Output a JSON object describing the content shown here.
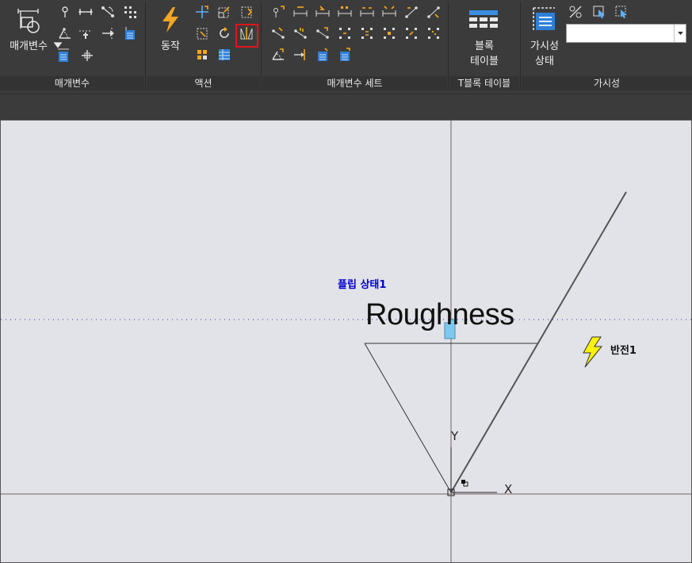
{
  "ribbon": {
    "panels": [
      {
        "label": "매개변수"
      },
      {
        "label": "액션"
      },
      {
        "label": "매개변수 세트"
      },
      {
        "label": "T블록 테이블"
      },
      {
        "label": "가시성"
      }
    ],
    "buttons": {
      "parameters_label": "매개변수",
      "action_label": "동작",
      "block_table_line1": "블록",
      "block_table_line2": "테이블",
      "visibility_line1": "가시성",
      "visibility_line2": "상태"
    },
    "visibility_combo": {
      "value": ""
    }
  },
  "canvas": {
    "flip_state_label": "플립 상태1",
    "roughness_text": "Roughness",
    "flip_param_label": "반전1",
    "axis_y": "Y",
    "axis_x": "X"
  },
  "colors": {
    "ribbon_bg": "#3b3b3b",
    "canvas_bg": "#e2e3e8",
    "highlight": "#e0151b",
    "flip_label": "#0000cc",
    "arrow_fill": "#7ec8f0",
    "bolt_fill": "#f7f10d"
  },
  "icons": [
    "point-parameter-icon",
    "linear-parameter-icon",
    "polar-parameter-icon",
    "xy-parameter-icon",
    "rotation-parameter-icon",
    "alignment-parameter-icon",
    "flip-parameter-icon",
    "visibility-parameter-icon",
    "lookup-parameter-icon",
    "basepoint-parameter-icon",
    "move-action-icon",
    "scale-action-icon",
    "stretch-action-icon",
    "polar-stretch-action-icon",
    "rotate-action-icon",
    "flip-action-icon",
    "array-action-icon",
    "lookup-action-icon",
    "block-table-icon",
    "visibility-states-icon",
    "make-visible-icon",
    "make-invisible-icon",
    "visibility-mode-icon"
  ]
}
